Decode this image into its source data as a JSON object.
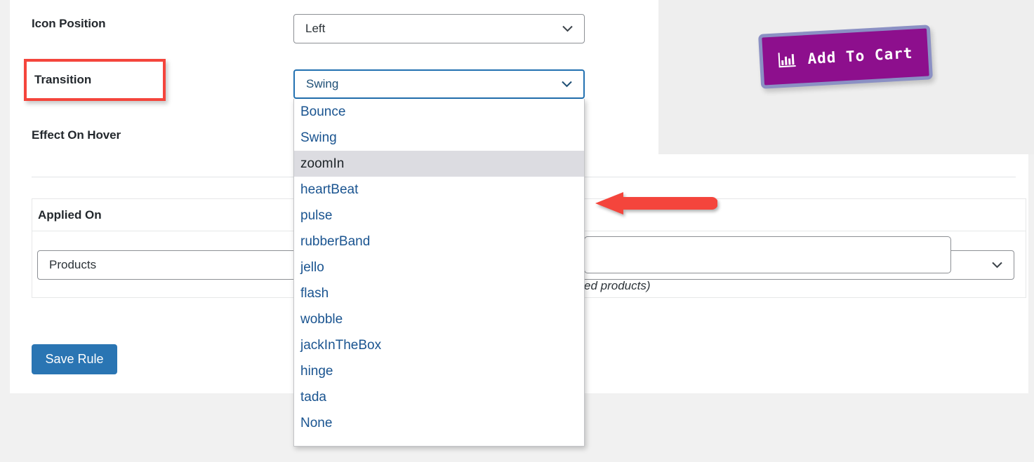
{
  "form": {
    "rows": [
      {
        "label": "Icon Position",
        "value": "Left"
      },
      {
        "label": "Transition",
        "value": "Swing"
      },
      {
        "label": "Effect On Hover",
        "value": ""
      }
    ]
  },
  "transition_dropdown": {
    "selected": "zoomIn",
    "options": [
      "Bounce",
      "Swing",
      "zoomIn",
      "heartBeat",
      "pulse",
      "rubberBand",
      "jello",
      "flash",
      "wobble",
      "jackInTheBox",
      "hinge",
      "tada",
      "None"
    ]
  },
  "applied_on": {
    "title": "Applied On",
    "select_value": "Products",
    "input_value": "",
    "input_placeholder": "",
    "hint": "ed products)"
  },
  "actions": {
    "save_label": "Save Rule"
  },
  "preview": {
    "button_label": "Add To Cart",
    "icon": "bar-chart-icon"
  },
  "annotations": {
    "highlight_label": "Transition",
    "highlight_color": "#f4453c",
    "arrow_color": "#f4453c",
    "arrow_direction": "left"
  },
  "colors": {
    "page_background": "#f1f1f1",
    "card_background": "#ffffff",
    "preview_background": "#eeeeee",
    "accent_blue": "#2271b1",
    "save_button": "#2a75b3",
    "cart_button_fill": "#8d0f8d",
    "cart_button_border": "#8b90c4",
    "dropdown_link": "#1a5490",
    "dropdown_selected_bg": "#dcdce1"
  }
}
